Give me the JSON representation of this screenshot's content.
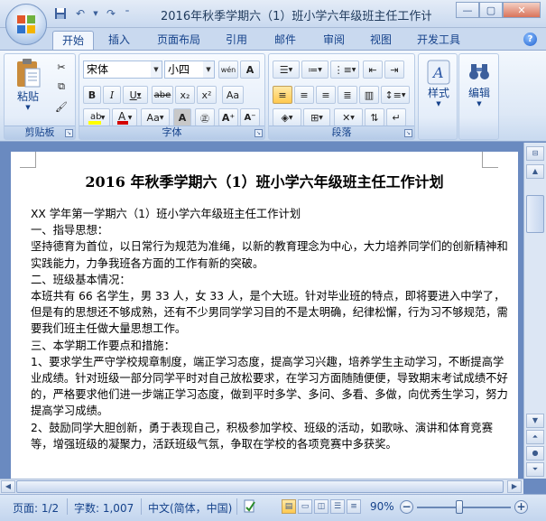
{
  "window": {
    "title": "2016年秋季学期六（1）班小学六年级班主任工作计划（...",
    "minimize": "—",
    "maximize": "▢",
    "close": "✕"
  },
  "qat": {
    "save_icon": "save-icon",
    "undo_icon": "undo-icon",
    "redo_icon": "redo-icon"
  },
  "tabs": [
    "开始",
    "插入",
    "页面布局",
    "引用",
    "邮件",
    "审阅",
    "视图",
    "开发工具"
  ],
  "active_tab": "开始",
  "ribbon": {
    "clipboard": {
      "label": "剪贴板",
      "paste_label": "粘贴"
    },
    "font": {
      "label": "字体",
      "font_name": "宋体",
      "font_size": "小四",
      "bold": "B",
      "italic": "I",
      "underline": "U",
      "strike": "abe",
      "subscript": "x₂",
      "superscript": "x²",
      "font_size_btn": "Aa",
      "grow": "A",
      "shrink": "A",
      "char_border": "A",
      "wen": "wén",
      "highlight_color": "#ffff00",
      "font_color": "#d40000"
    },
    "paragraph": {
      "label": "段落"
    },
    "styles": {
      "label": "样式"
    },
    "editing": {
      "label": "编辑"
    }
  },
  "document": {
    "title": "2016 年秋季学期六（1）班小学六年级班主任工作计划",
    "paragraphs": [
      "XX 学年第一学期六（1）班小学六年级班主任工作计划",
      "一、指导思想：",
      "坚持德育为首位，以日常行为规范为准绳，以新的教育理念为中心，大力培养同学们的创新精神和实践能力，力争我班各方面的工作有新的突破。",
      "二、班级基本情况：",
      "本班共有 66 名学生，男 33 人，女 33 人，是个大班。针对毕业班的特点，即将要进入中学了，但是有的思想还不够成熟，还有不少男同学学习目的不是太明确，纪律松懈，行为习不够规范，需要我们班主任做大量思想工作。",
      "三、本学期工作要点和措施：",
      "1、要求学生严守学校规章制度，端正学习态度，提高学习兴趣，培养学生主动学习，不断提高学业成绩。针对班级一部分同学平时对自己放松要求，在学习方面随随便便，导致期末考试成绩不好的，严格要求他们进一步端正学习态度，做到平时多学、多问、多看、多做，向优秀生学习，努力提高学习成绩。",
      "2、鼓励同学大胆创新，勇于表现自己，积极参加学校、班级的活动，如歌咏、演讲和体育竞赛等，增强班级的凝聚力，活跃班级气氛，争取在学校的各项竞赛中多获奖。"
    ]
  },
  "statusbar": {
    "page": "页面: 1/2",
    "words": "字数: 1,007",
    "language": "中文(简体，中国)",
    "zoom": "90%",
    "zoom_fraction": 0.45
  }
}
